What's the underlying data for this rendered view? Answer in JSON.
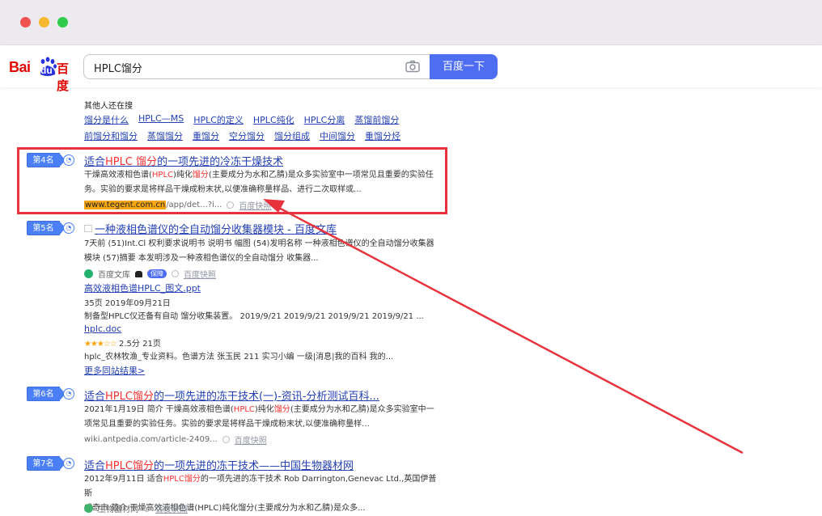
{
  "search": {
    "query": "HPLC馏分",
    "button_label": "百度一下"
  },
  "logo": {
    "latin": "Bai",
    "paw_text": "du",
    "chinese": "百度"
  },
  "related": {
    "title": "其他人还在搜",
    "row1": [
      "馏分是什么",
      "HPLC—MS",
      "HPLC的定义",
      "HPLC纯化",
      "HPLC分离",
      "蒸馏前馏分"
    ],
    "row2": [
      "前馏分和馏分",
      "蒸馏馏分",
      "重馏分",
      "空分馏分",
      "馏分组成",
      "中间馏分",
      "重馏分烃"
    ]
  },
  "results": [
    {
      "rank": "第4名",
      "title_pre": "适合",
      "title_hl1": "HPLC 馏分",
      "title_post": "的一项先进的冷冻干燥技术",
      "abs1_pre": "干燥高效液相色谱(",
      "abs1_hl1": "HPLC",
      "abs1_mid": ")纯化",
      "abs1_hl2": "馏分",
      "abs1_post": "(主要成分为水和乙腈)是众多实验室中一项常见且重要的实验任",
      "abs2": "务。实验的要求是将样品干燥成粉末状,以便准确称量样品、进行二次取样或...",
      "url_hl": "www.tegent.com.cn",
      "url_rest": "/app/det...?i...",
      "cache": "百度快照"
    },
    {
      "rank": "第5名",
      "title": "一种液相色谱仪的全自动馏分收集器模块 - 百度文库",
      "abs1": "7天前 (51)Int.Cl 权利要求说明书 说明书 幅图 (54)发明名称 一种液相色谱仪的全自动馏分收集器",
      "abs2": "模块 (57)摘要 本发明涉及一种液相色谱仪的全自动馏分 收集器...",
      "source": "百度文库",
      "badge": "保障",
      "cache": "百度快照",
      "sub1_title": "高效液相色谱HPLC_图文.ppt",
      "sub1_meta": "35页  2019年09月21日",
      "sub1_desc": "制备型HPLC仪还备有自动 馏分收集装置。 2019/9/21 2019/9/21 2019/9/21 2019/9/21 ...",
      "sub2_title": "hplc.doc",
      "sub2_stars": "★★★☆☆",
      "sub2_rating": "2.5分  21页",
      "sub2_desc": "hplc_农林牧渔_专业资料。色谱方法 张玉民 211 实习小编 一级|消息|我的百科 我的...",
      "more": "更多同站结果>"
    },
    {
      "rank": "第6名",
      "title_pre": "适合",
      "title_hl1": "HPLC馏分",
      "title_post": "的一项先进的冻干技术(一)-资讯-分析测试百科...",
      "abs1_pre": "2021年1月19日  简介 干燥高效液相色谱(",
      "abs1_hl1": "HPLC",
      "abs1_mid": ")纯化",
      "abs1_hl2": "馏分",
      "abs1_post": "(主要成分为水和乙腈)是众多实验室中一",
      "abs2": "项常见且重要的实验任务。实验的要求是将样品干燥成粉末状,以便准确称量样...",
      "url": "wiki.antpedia.com/article-2409...",
      "cache": "百度快照"
    },
    {
      "rank": "第7名",
      "title_pre": "适合",
      "title_hl1": "HPLC馏分",
      "title_post": "的一项先进的冻干技术——中国生物器材网",
      "abs1_pre": "2012年9月11日  适合",
      "abs1_hl1": "HPLC馏分",
      "abs1_post": "的一项先进的冻干技术 Rob Darrington,Genevac Ltd.,英国伊普斯",
      "abs2": "威奇市 简介 干燥高效液相色谱(HPLC)纯化馏分(主要成分为水和乙腈)是众多...",
      "source": "生物器材网",
      "cache": "百度快照"
    }
  ],
  "colors": {
    "accent": "#4e6ef2",
    "link": "#2440b3",
    "highlight": "#f73131",
    "annotation": "#e8333d"
  }
}
